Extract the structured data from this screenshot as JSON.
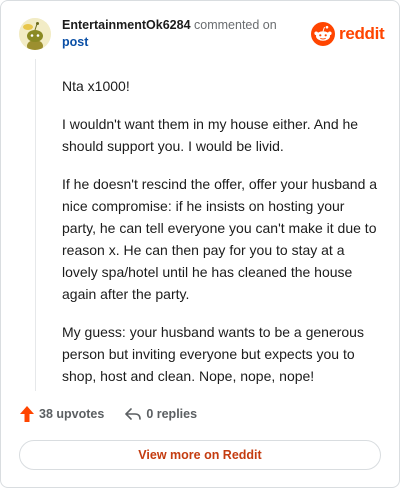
{
  "header": {
    "username": "EntertainmentOk6284",
    "action_text": "commented on",
    "post_link": "post",
    "avatar_icon": "snoo-avatar-icon",
    "brand_icon": "reddit-snoo-icon",
    "brand_name": "reddit"
  },
  "comment": {
    "paragraphs": [
      "Nta x1000!",
      "I wouldn't want them in my house either. And he should support you. I would be livid.",
      "If he doesn't rescind the offer, offer your husband a nice compromise: if he insists on hosting your party, he can tell everyone you can't make it due to reason x. He can then pay for you to stay at a lovely spa/hotel until he has cleaned the house again after the party.",
      "My guess: your husband wants to be a generous person but inviting everyone but expects you to shop, host and clean. Nope, nope, nope!"
    ]
  },
  "footer": {
    "upvotes": "38 upvotes",
    "upvote_icon": "upvote-arrow-icon",
    "replies": "0 replies",
    "reply_icon": "reply-arrow-icon",
    "view_more": "View more on Reddit"
  },
  "colors": {
    "brand": "#ff4500",
    "link": "#0a4fa6",
    "view_more_text": "#c43c10",
    "border": "#d9dde0"
  }
}
